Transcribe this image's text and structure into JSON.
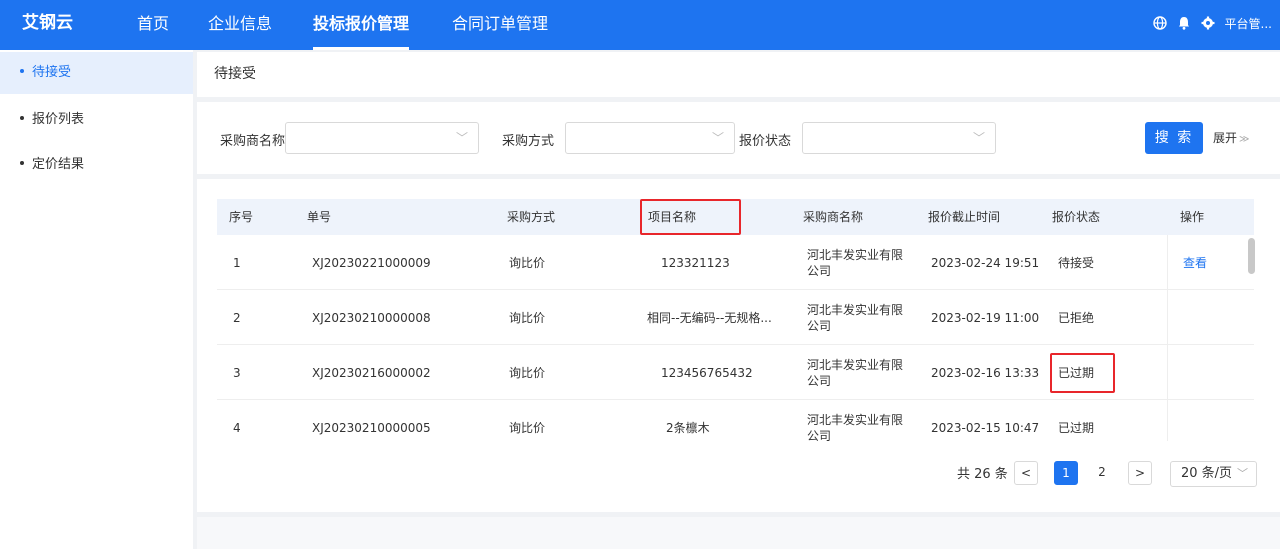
{
  "header": {
    "brand": "艾钢云",
    "nav": [
      "首页",
      "企业信息",
      "投标报价管理",
      "合同订单管理"
    ],
    "active_nav": "投标报价管理",
    "user_label": "平台管..."
  },
  "sidebar": {
    "items": [
      {
        "label": "待接受",
        "active": true
      },
      {
        "label": "报价列表",
        "active": false
      },
      {
        "label": "定价结果",
        "active": false
      }
    ]
  },
  "breadcrumb": "待接受",
  "filters": {
    "buyer_label": "采购商名称",
    "method_label": "采购方式",
    "status_label": "报价状态",
    "search_label": "搜 索",
    "expand_label": "展开"
  },
  "table": {
    "columns": [
      "序号",
      "单号",
      "采购方式",
      "项目名称",
      "采购商名称",
      "报价截止时间",
      "报价状态",
      "操作"
    ],
    "rows": [
      {
        "no": "1",
        "order": "XJ20230221000009",
        "method": "询比价",
        "project": "123321123",
        "buyer": "河北丰发实业有限公司",
        "deadline": "2023-02-24 19:51",
        "status": "待接受",
        "action": "查看"
      },
      {
        "no": "2",
        "order": "XJ20230210000008",
        "method": "询比价",
        "project": "相同--无编码--无规格...",
        "buyer": "河北丰发实业有限公司",
        "deadline": "2023-02-19 11:00",
        "status": "已拒绝",
        "action": ""
      },
      {
        "no": "3",
        "order": "XJ20230216000002",
        "method": "询比价",
        "project": "123456765432",
        "buyer": "河北丰发实业有限公司",
        "deadline": "2023-02-16 13:33",
        "status": "已过期",
        "action": ""
      },
      {
        "no": "4",
        "order": "XJ20230210000005",
        "method": "询比价",
        "project": "2条檩木",
        "buyer": "河北丰发实业有限公司",
        "deadline": "2023-02-15 10:47",
        "status": "已过期",
        "action": ""
      }
    ]
  },
  "pagination": {
    "total": "共 26 条",
    "prev": "<",
    "pages": [
      "1",
      "2"
    ],
    "current": "1",
    "next": ">",
    "page_size": "20 条/页"
  },
  "colors": {
    "primary": "#1e74f0",
    "highlight": "#e8262b"
  }
}
